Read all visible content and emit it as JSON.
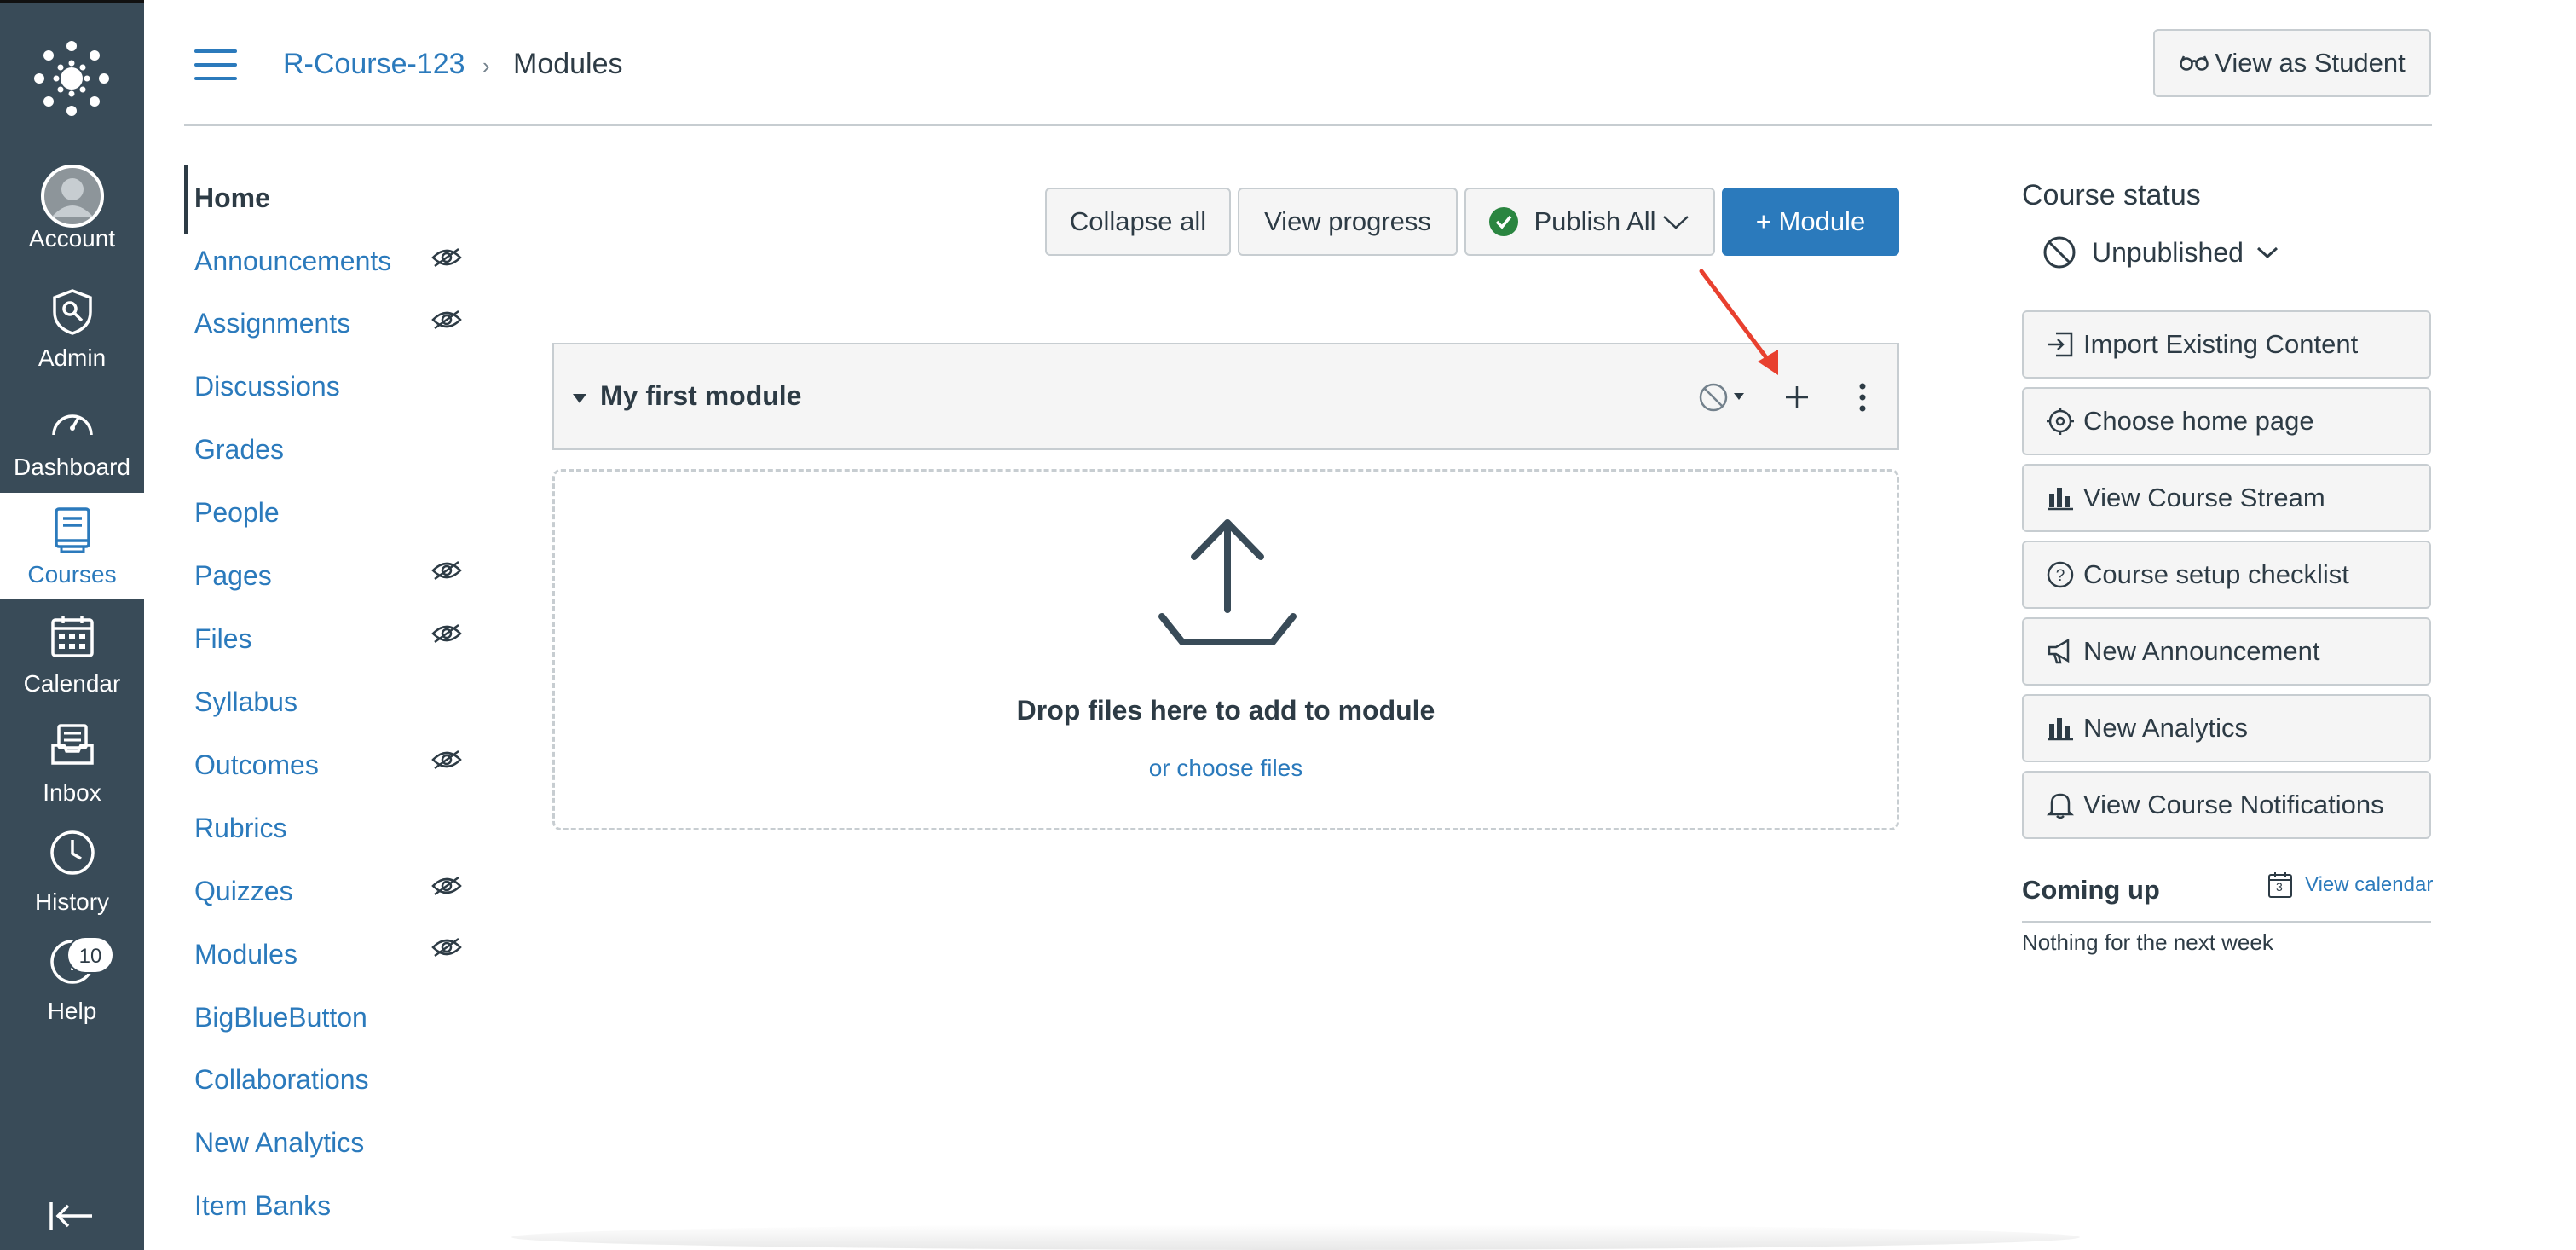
{
  "global_nav": {
    "items": [
      {
        "label": "Account",
        "icon": "avatar-icon"
      },
      {
        "label": "Admin",
        "icon": "shield-icon"
      },
      {
        "label": "Dashboard",
        "icon": "dashboard-icon"
      },
      {
        "label": "Courses",
        "icon": "book-icon"
      },
      {
        "label": "Calendar",
        "icon": "calendar-icon"
      },
      {
        "label": "Inbox",
        "icon": "inbox-icon"
      },
      {
        "label": "History",
        "icon": "clock-icon"
      },
      {
        "label": "Help",
        "icon": "help-icon"
      }
    ],
    "help_badge": "10",
    "active": "Courses",
    "bg_color": "#394b58"
  },
  "header": {
    "course": "R-Course-123",
    "separator": "›",
    "current": "Modules",
    "view_as_student": "View as Student"
  },
  "course_nav": {
    "items": [
      {
        "label": "Home",
        "hidden": false
      },
      {
        "label": "Announcements",
        "hidden": true
      },
      {
        "label": "Assignments",
        "hidden": true
      },
      {
        "label": "Discussions",
        "hidden": false
      },
      {
        "label": "Grades",
        "hidden": false
      },
      {
        "label": "People",
        "hidden": false
      },
      {
        "label": "Pages",
        "hidden": true
      },
      {
        "label": "Files",
        "hidden": true
      },
      {
        "label": "Syllabus",
        "hidden": false
      },
      {
        "label": "Outcomes",
        "hidden": true
      },
      {
        "label": "Rubrics",
        "hidden": false
      },
      {
        "label": "Quizzes",
        "hidden": true
      },
      {
        "label": "Modules",
        "hidden": true
      },
      {
        "label": "BigBlueButton",
        "hidden": false
      },
      {
        "label": "Collaborations",
        "hidden": false
      },
      {
        "label": "New Analytics",
        "hidden": false
      },
      {
        "label": "Item Banks",
        "hidden": false
      }
    ]
  },
  "toolbar": {
    "collapse_all": "Collapse all",
    "view_progress": "View progress",
    "publish_all": "Publish All",
    "add_module": "+ Module"
  },
  "module": {
    "title": "My first module",
    "drop_text": "Drop files here to add to module",
    "choose_files": "or choose files"
  },
  "sidebar": {
    "course_status_heading": "Course status",
    "status": "Unpublished",
    "buttons": [
      {
        "label": "Import Existing Content",
        "icon": "import-icon"
      },
      {
        "label": "Choose home page",
        "icon": "target-icon"
      },
      {
        "label": "View Course Stream",
        "icon": "bar-chart-icon"
      },
      {
        "label": "Course setup checklist",
        "icon": "question-icon"
      },
      {
        "label": "New Announcement",
        "icon": "megaphone-icon"
      },
      {
        "label": "New Analytics",
        "icon": "bar-chart-icon"
      },
      {
        "label": "View Course Notifications",
        "icon": "bell-icon"
      }
    ],
    "coming_up": "Coming up",
    "view_calendar": "View calendar",
    "calendar_day": "3",
    "nothing": "Nothing for the next week"
  },
  "colors": {
    "link": "#2b7abc",
    "primary_button": "#2b7abc",
    "published_check": "#2a8540",
    "annotation_arrow": "#e8402f"
  }
}
